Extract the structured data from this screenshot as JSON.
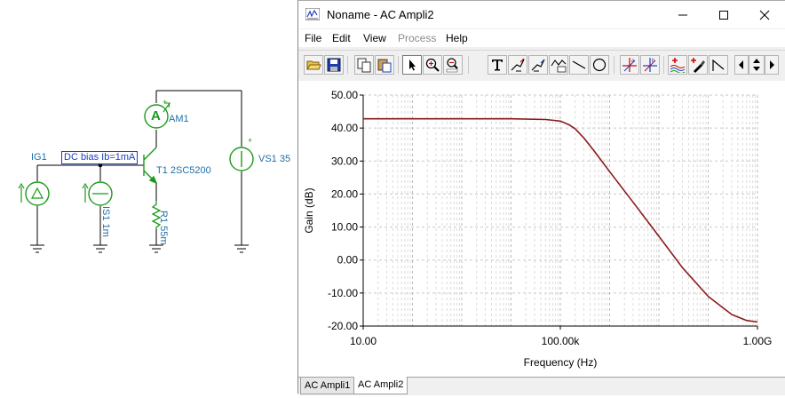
{
  "schematic": {
    "ig1_label": "IG1",
    "dc_bias_label": "DC bias Ib=1mA",
    "is1_label": "IS1 1m",
    "t1_label": "T1 2SC5200",
    "r1_label": "R1 55m",
    "am1_label": "AM1",
    "vs1_label": "VS1 35",
    "ammeter_symbol": "A",
    "plus_sign": "+"
  },
  "window": {
    "title": "Noname - AC Ampli2",
    "menu": [
      "File",
      "Edit",
      "View",
      "Process",
      "Help"
    ],
    "disabled_menu_index": 3,
    "toolbar_icons": [
      "open-folder-icon",
      "save-icon",
      "copy-icon",
      "paste-icon",
      "select-arrow-icon",
      "zoom-in-icon",
      "zoom-fit-icon",
      "text-tool-icon",
      "cursor-a-icon",
      "cursor-b-icon",
      "formula-icon",
      "line-tool-icon",
      "circle-tool-icon",
      "cursor-a-cross-icon",
      "cursor-b-cross-icon",
      "add-curve-icon",
      "marker-icon",
      "step-icon",
      "scroll-left-icon",
      "scroll-updown-icon",
      "scroll-right-icon"
    ],
    "tabs": [
      "AC Ampli1",
      "AC Ampli2"
    ],
    "active_tab": 1
  },
  "chart_data": {
    "type": "line",
    "xlabel": "Frequency (Hz)",
    "ylabel": "Gain (dB)",
    "x_scale": "log",
    "xlim": [
      10,
      1000000000
    ],
    "ylim": [
      -20,
      50
    ],
    "x_ticks": [
      {
        "value": 10,
        "label": "10.00"
      },
      {
        "value": 100000,
        "label": "100.00k"
      },
      {
        "value": 1000000000,
        "label": "1.00G"
      }
    ],
    "y_ticks": [
      {
        "value": 50,
        "label": "50.00"
      },
      {
        "value": 40,
        "label": "40.00"
      },
      {
        "value": 30,
        "label": "30.00"
      },
      {
        "value": 20,
        "label": "20.00"
      },
      {
        "value": 10,
        "label": "10.00"
      },
      {
        "value": 0,
        "label": "0.00"
      },
      {
        "value": -10,
        "label": "-10.00"
      },
      {
        "value": -20,
        "label": "-20.00"
      }
    ],
    "grid": true,
    "series": [
      {
        "color": "#8b1a1a",
        "x": [
          10,
          1000,
          10000,
          50000,
          100000,
          150000,
          200000,
          300000,
          500000,
          1000000,
          3000000,
          10000000,
          30000000,
          100000000,
          300000000,
          600000000,
          1000000000
        ],
        "y": [
          42.8,
          42.8,
          42.8,
          42.6,
          42.1,
          41.0,
          39.8,
          37.0,
          32.8,
          26.8,
          17.5,
          7.2,
          -2.3,
          -11.0,
          -16.5,
          -18.3,
          -18.8
        ]
      }
    ]
  }
}
